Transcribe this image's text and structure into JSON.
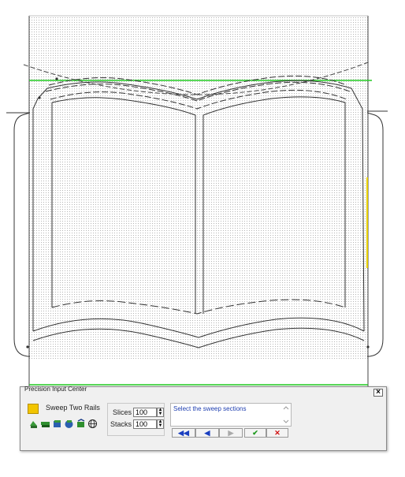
{
  "canvas": {
    "guide_color": "#22cc22",
    "accent_color": "#e8d000",
    "curve_color": "#333333"
  },
  "panel": {
    "title": "Precision Input Center",
    "close_glyph": "×",
    "command": {
      "swatch_color": "#f2c500",
      "name": "Sweep Two Rails"
    },
    "tools": [
      {
        "icon": "cube-green-icon"
      },
      {
        "icon": "layers-green-icon"
      },
      {
        "icon": "box-blue-icon"
      },
      {
        "icon": "sphere-blue-icon"
      },
      {
        "icon": "snap-icon"
      },
      {
        "icon": "globe-icon"
      }
    ],
    "fields": {
      "slices_label": "Slices",
      "slices_value": "100",
      "stacks_label": "Stacks",
      "stacks_value": "100"
    },
    "prompt": "Select the sweep sections",
    "nav": {
      "first": "◀◀",
      "prev": "◀",
      "next": "▶",
      "accept": "✔",
      "cancel": "✕"
    }
  }
}
